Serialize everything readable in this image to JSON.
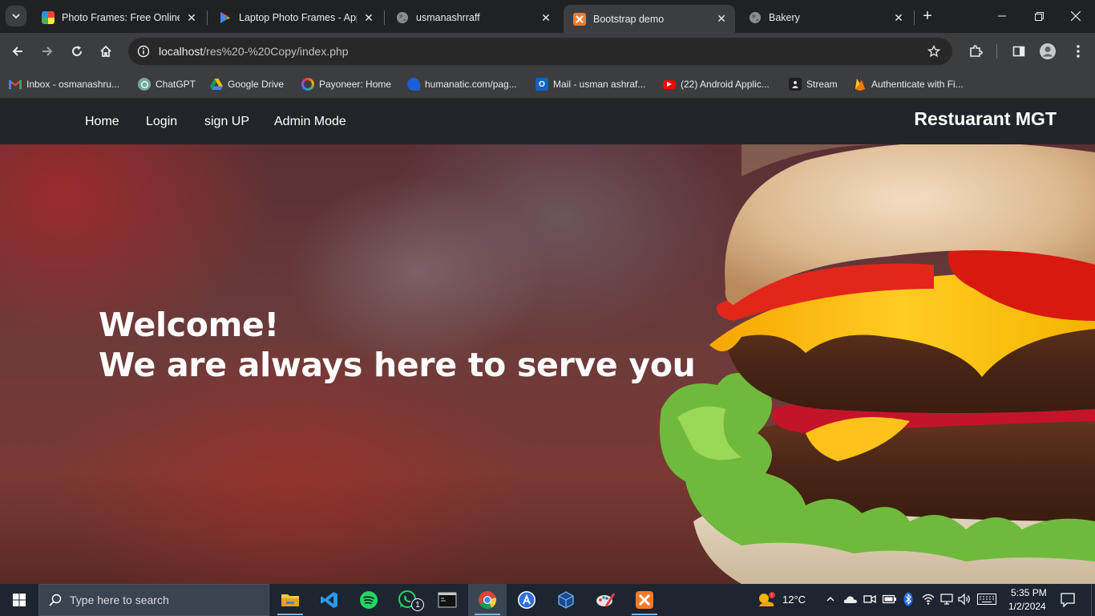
{
  "browser": {
    "tabs": [
      {
        "title": "Photo Frames: Free Online Photo Frames",
        "favicon": "colorful-squares-icon"
      },
      {
        "title": "Laptop Photo Frames - Apps on Google Play",
        "favicon": "google-play-icon"
      },
      {
        "title": "usmanashrraff",
        "favicon": "globe-icon"
      },
      {
        "title": "Bootstrap demo",
        "favicon": "xampp-icon"
      },
      {
        "title": "Bakery",
        "favicon": "globe-icon"
      }
    ],
    "url_host": "localhost",
    "url_path": "/res%20-%20Copy/index.php",
    "bookmarks": [
      {
        "label": "Inbox - osmanashru...",
        "icon": "gmail-icon"
      },
      {
        "label": "ChatGPT",
        "icon": "chatgpt-icon"
      },
      {
        "label": "Google Drive",
        "icon": "google-drive-icon"
      },
      {
        "label": "Payoneer: Home",
        "icon": "payoneer-icon"
      },
      {
        "label": "humanatic.com/pag...",
        "icon": "humanatic-icon"
      },
      {
        "label": "Mail - usman ashraf...",
        "icon": "outlook-icon"
      },
      {
        "label": "(22) Android Applic...",
        "icon": "youtube-icon"
      },
      {
        "label": "Stream",
        "icon": "stream-icon"
      },
      {
        "label": "Authenticate with Fi...",
        "icon": "firebase-icon"
      }
    ]
  },
  "site": {
    "nav": [
      "Home",
      "Login",
      "sign UP",
      "Admin Mode"
    ],
    "brand": "Restuarant MGT",
    "hero_line1": "Welcome!",
    "hero_line2": "We are always here to serve you"
  },
  "taskbar": {
    "search_placeholder": "Type here to search",
    "weather": "12°C",
    "time": "5:35 PM",
    "date": "1/2/2024",
    "whatsapp_badge": "1"
  },
  "colors": {
    "navbar_bg": "#212529",
    "browser_frame": "#202124",
    "toolbar": "#3c3d40",
    "taskbar": "#1c2530"
  }
}
